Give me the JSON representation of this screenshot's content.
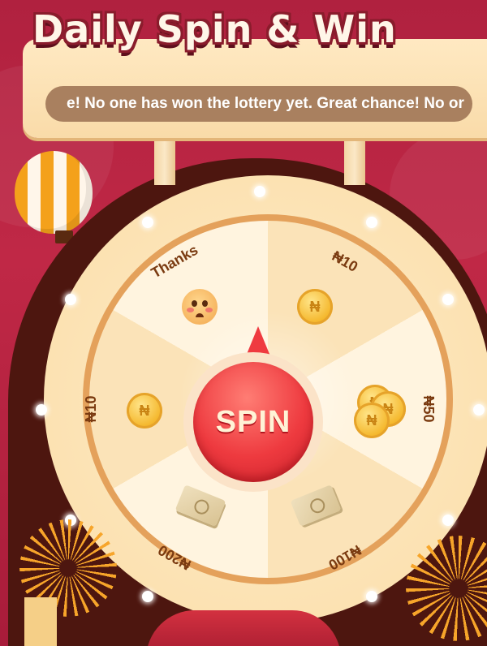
{
  "header": {
    "title": "Daily Spin & Win"
  },
  "marquee": {
    "text": "e! No one has won the lottery yet.     Great chance! No or"
  },
  "wheel": {
    "prizes": [
      {
        "label": "Thanks",
        "icon": "crying-face-icon"
      },
      {
        "label": "₦10",
        "icon": "coin-icon"
      },
      {
        "label": "₦50",
        "icon": "coin-stack-icon"
      },
      {
        "label": "₦100",
        "icon": "cash-stack-icon"
      },
      {
        "label": "₦200",
        "icon": "cash-stack-icon"
      },
      {
        "label": "₦10",
        "icon": "coin-icon"
      }
    ],
    "spin_label": "SPIN"
  },
  "colors": {
    "background": "#b0213f",
    "wheel_cream": "#fbe3b8",
    "wheel_ring": "#e4a15b",
    "spin_red": "#ee3a3f",
    "label_brown": "#7a3a10",
    "marquee_bg": "#a9805f"
  }
}
